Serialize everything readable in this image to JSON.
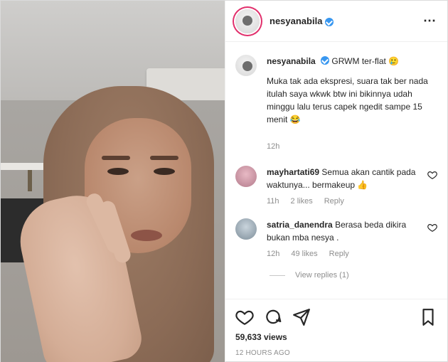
{
  "post": {
    "username": "nesyanabila",
    "caption_title": "GRWM ter-flat 🥲",
    "caption_text": "Muka tak ada ekspresi, suara tak ber nada itulah saya wkwk btw ini bikinnya udah minggu lalu terus capek ngedit sampe 15 menit 😂",
    "caption_time": "12h"
  },
  "comments": [
    {
      "user": "mayhartati69",
      "text": "Semua akan cantik pada waktunya... bermakeup 👍",
      "time": "11h",
      "likes": "2 likes",
      "reply": "Reply"
    },
    {
      "user": "satria_danendra",
      "text": "Berasa beda dikira bukan mba nesya .",
      "time": "12h",
      "likes": "49 likes",
      "reply": "Reply",
      "view_replies": "View replies (1)"
    }
  ],
  "footer": {
    "views": "59,633 views",
    "ago": "12 HOURS AGO"
  },
  "icons": {
    "more": "more-icon",
    "like": "heart-icon",
    "comment": "comment-icon",
    "share": "share-icon",
    "save": "bookmark-icon"
  }
}
